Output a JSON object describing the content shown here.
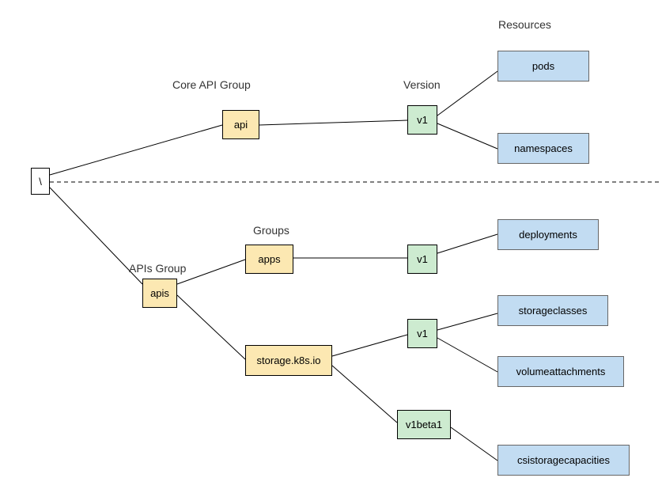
{
  "labels": {
    "resources": "Resources",
    "coreApiGroup": "Core API Group",
    "version": "Version",
    "apisGroup": "APIs Group",
    "groups": "Groups"
  },
  "nodes": {
    "root": "\\",
    "api": "api",
    "v1_core": "v1",
    "pods": "pods",
    "namespaces": "namespaces",
    "apis": "apis",
    "apps": "apps",
    "storage_k8s_io": "storage.k8s.io",
    "v1_apps": "v1",
    "v1_storage": "v1",
    "v1beta1": "v1beta1",
    "deployments": "deployments",
    "storageclasses": "storageclasses",
    "volumeattachments": "volumeattachments",
    "csistoragecapacities": "csistoragecapacities"
  }
}
